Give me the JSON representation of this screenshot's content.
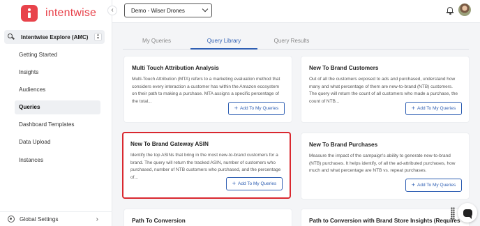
{
  "brand": {
    "name": "intentwise",
    "accent": "#e8434b"
  },
  "sidebar": {
    "module_label": "Intentwise Explore (AMC)",
    "items": [
      {
        "label": "Getting Started"
      },
      {
        "label": "Insights"
      },
      {
        "label": "Audiences"
      },
      {
        "label": "Queries",
        "active": true
      },
      {
        "label": "Dashboard Templates"
      },
      {
        "label": "Data Upload"
      },
      {
        "label": "Instances"
      }
    ],
    "global_settings_label": "Global Settings"
  },
  "header": {
    "account_selector": "Demo - Wiser Drones"
  },
  "tabs": [
    {
      "label": "My Queries"
    },
    {
      "label": "Query Library",
      "active": true
    },
    {
      "label": "Query Results"
    }
  ],
  "cards": [
    {
      "title": "Multi Touch Attribution Analysis",
      "description": "Multi-Touch Attribution (MTA) refers to a marketing evaluation method that considers every interaction a customer has within the Amazon ecosystem on their path to making a purchase. MTA assigns a specific percentage of the total...",
      "button": "Add To My Queries"
    },
    {
      "title": "New To Brand Customers",
      "description": "Out of all the customers exposed to ads and purchased, understand how many and what percentage of them are new-to-brand (NTB) customers. The query will return the count of all customers who made a purchase, the count of NTB...",
      "button": "Add To My Queries"
    },
    {
      "title": "New To Brand Gateway ASIN",
      "description": "Identify the top ASINs that bring in the most new-to-brand customers for a brand. The query will return the tracked ASIN, number of customers who purchased, number of NTB customers who purchased, and the percentage of...",
      "button": "Add To My Queries"
    },
    {
      "title": "New To Brand Purchases",
      "description": "Measure the impact of the campaign's ability to generate new-to-brand (NTB) purchases. It helps identify, of all the ad-attributed purchases, how much and what percentage are NTB vs. repeat purchases.",
      "button": "Add To My Queries"
    },
    {
      "title": "Path To Conversion",
      "description": "",
      "button": ""
    },
    {
      "title": "Path to Conversion with Brand Store Insights (Requires Brand...",
      "description": "",
      "button": ""
    }
  ],
  "colors": {
    "link_blue": "#2f5fb3",
    "highlight_red": "#d9282f"
  }
}
